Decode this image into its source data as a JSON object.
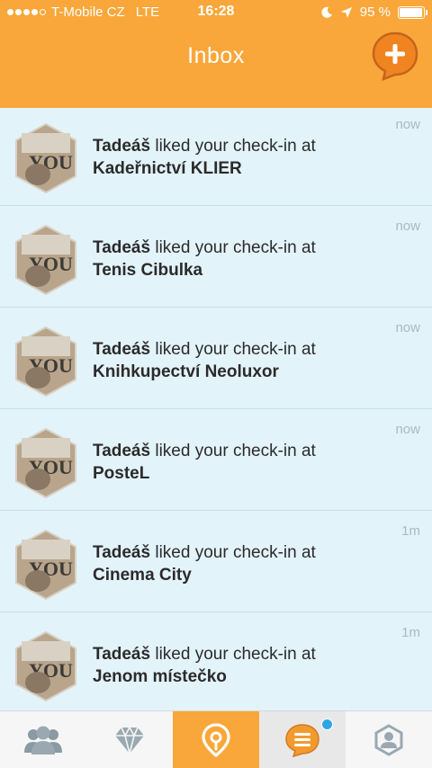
{
  "status": {
    "carrier": "T-Mobile CZ",
    "network": "LTE",
    "time": "16:28",
    "battery_text": "95 %",
    "battery_level": 0.95
  },
  "header": {
    "title": "Inbox"
  },
  "notifications": [
    {
      "user": "Tadeáš",
      "action": " liked your check-in at",
      "place": "Kadeřnictví KLIER",
      "time": "now"
    },
    {
      "user": "Tadeáš",
      "action": " liked your check-in at",
      "place": "Tenis Cibulka",
      "time": "now"
    },
    {
      "user": "Tadeáš",
      "action": " liked your check-in at",
      "place": "Knihkupectví Neoluxor",
      "time": "now"
    },
    {
      "user": "Tadeáš",
      "action": " liked your check-in at",
      "place": "PosteL",
      "time": "now"
    },
    {
      "user": "Tadeáš",
      "action": " liked your check-in at",
      "place": "Cinema City",
      "time": "1m"
    },
    {
      "user": "Tadeáš",
      "action": " liked your check-in at",
      "place": "Jenom místečko",
      "time": "1m"
    }
  ],
  "tabs": [
    {
      "icon": "friends-icon",
      "active": false
    },
    {
      "icon": "diamond-icon",
      "active": false
    },
    {
      "icon": "location-pin-icon",
      "active": true
    },
    {
      "icon": "inbox-bubble-icon",
      "active": false,
      "badge": true
    },
    {
      "icon": "profile-icon",
      "active": false
    }
  ],
  "colors": {
    "accent": "#f9a73a",
    "background": "#e3f3fa",
    "badge": "#2ea6e6",
    "compose": "#f08421"
  }
}
